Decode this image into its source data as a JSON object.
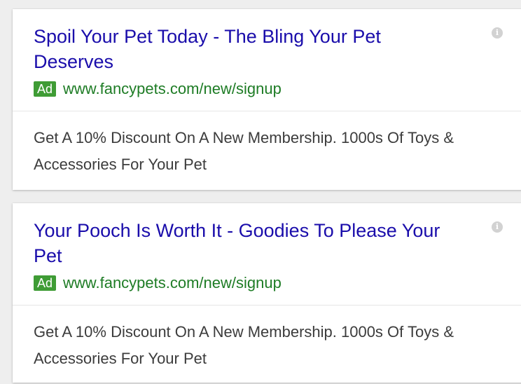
{
  "ads": [
    {
      "title": "Spoil Your Pet Today - The Bling Your Pet Deserves",
      "badge": "Ad",
      "url": "www.fancypets.com/new/signup",
      "description": "Get A 10% Discount On A New Membership. 1000s Of Toys & Accessories For Your Pet",
      "info_icon": "info-icon"
    },
    {
      "title": "Your Pooch Is Worth It - Goodies To Please Your Pet",
      "badge": "Ad",
      "url": "www.fancypets.com/new/signup",
      "description": "Get A 10% Discount On A New Membership. 1000s Of Toys & Accessories For Your Pet",
      "info_icon": "info-icon"
    }
  ],
  "colors": {
    "title": "#1a0dab",
    "badge_bg": "#3f9c35",
    "url": "#1e7c25",
    "description": "#3c3c3c",
    "background": "#eeeeee"
  }
}
